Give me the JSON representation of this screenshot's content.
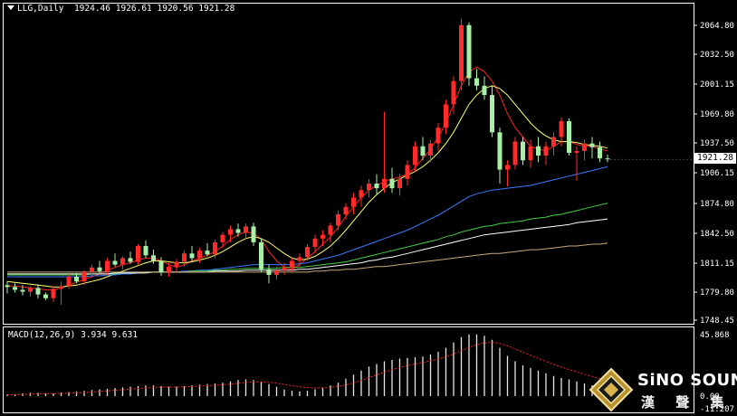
{
  "header": {
    "symbol": "LLG,Daily",
    "open": "1924.46",
    "high": "1926.61",
    "low": "1920.56",
    "close": "1921.28"
  },
  "macd": {
    "label": "MACD(12,26,9)",
    "main": "3.934",
    "signal": "9.631"
  },
  "price_axis_labels": [
    "2064.80",
    "2032.50",
    "2001.15",
    "1969.80",
    "1937.50",
    "1906.15",
    "1874.80",
    "1842.50",
    "1811.15",
    "1779.80",
    "1748.45"
  ],
  "macd_axis_labels": [
    "45.868",
    "0.00",
    "-11.207"
  ],
  "current_price": "1921.28",
  "logo": {
    "brand": "SiNO SOUND",
    "chinese": "漢 聲 集 團"
  },
  "colors": {
    "bull": "#ff2a2a",
    "bear": "#a8f0a8",
    "background": "#000000",
    "frame": "#ffffff"
  },
  "chart_data": {
    "type": "candlestick",
    "price_range": [
      1748.45,
      2080
    ],
    "macd_range": [
      -11.207,
      45.868
    ],
    "candles": [
      [
        1786,
        1790,
        1777,
        1784
      ],
      [
        1784,
        1788,
        1778,
        1781
      ],
      [
        1781,
        1786,
        1775,
        1779
      ],
      [
        1779,
        1785,
        1774,
        1783
      ],
      [
        1783,
        1787,
        1772,
        1776
      ],
      [
        1776,
        1778,
        1770,
        1772
      ],
      [
        1772,
        1785,
        1768,
        1782
      ],
      [
        1782,
        1790,
        1765,
        1785
      ],
      [
        1785,
        1798,
        1782,
        1795
      ],
      [
        1795,
        1799,
        1788,
        1790
      ],
      [
        1790,
        1802,
        1786,
        1800
      ],
      [
        1800,
        1808,
        1796,
        1805
      ],
      [
        1805,
        1812,
        1799,
        1801
      ],
      [
        1801,
        1815,
        1797,
        1812
      ],
      [
        1812,
        1820,
        1806,
        1808
      ],
      [
        1808,
        1817,
        1803,
        1815
      ],
      [
        1815,
        1822,
        1809,
        1811
      ],
      [
        1811,
        1830,
        1808,
        1828
      ],
      [
        1828,
        1834,
        1815,
        1818
      ],
      [
        1818,
        1824,
        1809,
        1812
      ],
      [
        1812,
        1816,
        1796,
        1800
      ],
      [
        1800,
        1810,
        1795,
        1806
      ],
      [
        1806,
        1814,
        1800,
        1811
      ],
      [
        1811,
        1823,
        1806,
        1820
      ],
      [
        1820,
        1828,
        1812,
        1815
      ],
      [
        1815,
        1826,
        1810,
        1823
      ],
      [
        1823,
        1831,
        1817,
        1819
      ],
      [
        1819,
        1835,
        1815,
        1832
      ],
      [
        1832,
        1843,
        1826,
        1840
      ],
      [
        1840,
        1850,
        1832,
        1846
      ],
      [
        1846,
        1852,
        1838,
        1842
      ],
      [
        1842,
        1852,
        1836,
        1849
      ],
      [
        1849,
        1853,
        1828,
        1832
      ],
      [
        1832,
        1836,
        1800,
        1803
      ],
      [
        1803,
        1808,
        1788,
        1797
      ],
      [
        1797,
        1806,
        1792,
        1802
      ],
      [
        1802,
        1810,
        1797,
        1805
      ],
      [
        1805,
        1815,
        1800,
        1812
      ],
      [
        1812,
        1820,
        1806,
        1816
      ],
      [
        1816,
        1830,
        1812,
        1827
      ],
      [
        1827,
        1840,
        1820,
        1836
      ],
      [
        1836,
        1845,
        1828,
        1840
      ],
      [
        1840,
        1853,
        1832,
        1850
      ],
      [
        1850,
        1866,
        1845,
        1862
      ],
      [
        1862,
        1874,
        1856,
        1870
      ],
      [
        1870,
        1885,
        1862,
        1880
      ],
      [
        1880,
        1893,
        1870,
        1888
      ],
      [
        1888,
        1900,
        1880,
        1895
      ],
      [
        1895,
        1905,
        1884,
        1890
      ],
      [
        1890,
        1972,
        1885,
        1900
      ],
      [
        1900,
        1912,
        1885,
        1890
      ],
      [
        1890,
        1905,
        1882,
        1900
      ],
      [
        1900,
        1920,
        1893,
        1915
      ],
      [
        1915,
        1940,
        1908,
        1935
      ],
      [
        1935,
        1945,
        1920,
        1925
      ],
      [
        1925,
        1942,
        1918,
        1938
      ],
      [
        1938,
        1960,
        1930,
        1955
      ],
      [
        1955,
        1985,
        1948,
        1980
      ],
      [
        1980,
        2010,
        1970,
        2005
      ],
      [
        2005,
        2072,
        1995,
        2065
      ],
      [
        2065,
        2068,
        2000,
        2008
      ],
      [
        2008,
        2018,
        1995,
        2000
      ],
      [
        2000,
        2010,
        1985,
        1990
      ],
      [
        1990,
        2000,
        1945,
        1950
      ],
      [
        1950,
        1955,
        1895,
        1910
      ],
      [
        1910,
        1920,
        1892,
        1915
      ],
      [
        1915,
        1945,
        1910,
        1940
      ],
      [
        1940,
        1945,
        1915,
        1920
      ],
      [
        1920,
        1942,
        1912,
        1935
      ],
      [
        1935,
        1945,
        1918,
        1925
      ],
      [
        1925,
        1940,
        1915,
        1935
      ],
      [
        1935,
        1950,
        1925,
        1945
      ],
      [
        1945,
        1966,
        1935,
        1962
      ],
      [
        1962,
        1965,
        1925,
        1928
      ],
      [
        1928,
        1935,
        1898,
        1930
      ],
      [
        1930,
        1942,
        1920,
        1938
      ],
      [
        1938,
        1945,
        1922,
        1934
      ],
      [
        1934,
        1940,
        1918,
        1922
      ],
      [
        1922,
        1926,
        1918,
        1921
      ]
    ],
    "ma_lines": [
      {
        "color": "#ff2020",
        "values": [
          1785,
          1785,
          1784,
          1783,
          1782,
          1781,
          1781,
          1783,
          1786,
          1789,
          1792,
          1795,
          1798,
          1802,
          1805,
          1808,
          1810,
          1813,
          1815,
          1815,
          1812,
          1808,
          1805,
          1808,
          1812,
          1815,
          1818,
          1822,
          1828,
          1835,
          1840,
          1843,
          1842,
          1835,
          1822,
          1812,
          1805,
          1803,
          1808,
          1815,
          1822,
          1830,
          1838,
          1848,
          1860,
          1870,
          1880,
          1888,
          1893,
          1897,
          1900,
          1902,
          1905,
          1912,
          1922,
          1932,
          1945,
          1960,
          1980,
          2000,
          2015,
          2020,
          2015,
          2005,
          1990,
          1970,
          1955,
          1945,
          1935,
          1932,
          1930,
          1935,
          1940,
          1940,
          1937,
          1935,
          1935,
          1932,
          1930
        ]
      },
      {
        "color": "#ffff66",
        "values": [
          1790,
          1789,
          1788,
          1787,
          1786,
          1785,
          1784,
          1784,
          1785,
          1786,
          1788,
          1790,
          1792,
          1795,
          1798,
          1801,
          1804,
          1807,
          1810,
          1812,
          1812,
          1811,
          1810,
          1810,
          1811,
          1813,
          1815,
          1818,
          1822,
          1827,
          1832,
          1836,
          1838,
          1836,
          1832,
          1826,
          1820,
          1815,
          1813,
          1814,
          1817,
          1822,
          1828,
          1836,
          1845,
          1855,
          1865,
          1875,
          1883,
          1890,
          1896,
          1900,
          1904,
          1908,
          1913,
          1920,
          1928,
          1938,
          1950,
          1965,
          1980,
          1990,
          1997,
          2000,
          1997,
          1990,
          1980,
          1970,
          1960,
          1952,
          1946,
          1942,
          1940,
          1940,
          1939,
          1937,
          1936,
          1935,
          1933
        ]
      },
      {
        "color": "#3a7bff",
        "values": [
          1795,
          1795,
          1795,
          1795,
          1795,
          1795,
          1795,
          1795,
          1795,
          1795,
          1795,
          1796,
          1796,
          1797,
          1797,
          1798,
          1798,
          1799,
          1800,
          1800,
          1800,
          1800,
          1800,
          1801,
          1801,
          1802,
          1802,
          1803,
          1804,
          1805,
          1806,
          1807,
          1808,
          1808,
          1808,
          1808,
          1808,
          1808,
          1809,
          1810,
          1812,
          1814,
          1816,
          1818,
          1821,
          1824,
          1827,
          1830,
          1833,
          1836,
          1839,
          1842,
          1845,
          1849,
          1853,
          1857,
          1861,
          1866,
          1871,
          1876,
          1881,
          1884,
          1886,
          1888,
          1889,
          1890,
          1891,
          1892,
          1893,
          1895,
          1897,
          1899,
          1901,
          1903,
          1905,
          1907,
          1909,
          1911,
          1913
        ]
      },
      {
        "color": "#44cc44",
        "values": [
          1797,
          1797,
          1797,
          1797,
          1797,
          1797,
          1797,
          1797,
          1797,
          1797,
          1797,
          1798,
          1798,
          1798,
          1798,
          1799,
          1799,
          1799,
          1800,
          1800,
          1800,
          1800,
          1800,
          1800,
          1801,
          1801,
          1801,
          1802,
          1802,
          1803,
          1803,
          1804,
          1804,
          1804,
          1804,
          1804,
          1805,
          1805,
          1805,
          1806,
          1807,
          1808,
          1809,
          1810,
          1811,
          1813,
          1815,
          1817,
          1819,
          1821,
          1823,
          1825,
          1827,
          1829,
          1831,
          1833,
          1835,
          1838,
          1840,
          1843,
          1845,
          1847,
          1849,
          1850,
          1852,
          1853,
          1854,
          1855,
          1857,
          1858,
          1859,
          1861,
          1862,
          1864,
          1866,
          1868,
          1870,
          1872,
          1874
        ]
      },
      {
        "color": "#ffffff",
        "values": [
          1798,
          1798,
          1798,
          1798,
          1798,
          1798,
          1798,
          1798,
          1798,
          1798,
          1798,
          1798,
          1798,
          1798,
          1799,
          1799,
          1799,
          1799,
          1799,
          1800,
          1800,
          1800,
          1800,
          1800,
          1800,
          1800,
          1800,
          1801,
          1801,
          1801,
          1801,
          1802,
          1802,
          1802,
          1802,
          1802,
          1802,
          1802,
          1803,
          1803,
          1804,
          1805,
          1806,
          1807,
          1808,
          1809,
          1810,
          1812,
          1813,
          1815,
          1816,
          1818,
          1820,
          1822,
          1824,
          1826,
          1828,
          1830,
          1832,
          1834,
          1836,
          1838,
          1840,
          1841,
          1842,
          1843,
          1844,
          1845,
          1846,
          1847,
          1848,
          1849,
          1850,
          1851,
          1853,
          1854,
          1855,
          1856,
          1857
        ]
      },
      {
        "color": "#c8a878",
        "values": [
          1800,
          1800,
          1800,
          1800,
          1800,
          1800,
          1800,
          1800,
          1800,
          1800,
          1800,
          1800,
          1800,
          1800,
          1800,
          1800,
          1800,
          1800,
          1800,
          1800,
          1800,
          1800,
          1800,
          1800,
          1800,
          1800,
          1800,
          1800,
          1800,
          1800,
          1800,
          1800,
          1800,
          1800,
          1800,
          1800,
          1800,
          1800,
          1800,
          1800,
          1801,
          1801,
          1802,
          1802,
          1803,
          1803,
          1804,
          1805,
          1806,
          1806,
          1807,
          1808,
          1809,
          1810,
          1811,
          1812,
          1813,
          1814,
          1815,
          1816,
          1817,
          1818,
          1819,
          1820,
          1820,
          1821,
          1822,
          1823,
          1824,
          1824,
          1825,
          1826,
          1827,
          1828,
          1828,
          1829,
          1830,
          1830,
          1831
        ]
      }
    ],
    "macd_hist": [
      1,
      1.5,
      2,
      2.5,
      2.5,
      2,
      2,
      2.5,
      3,
      3.5,
      4,
      4.5,
      5,
      5.5,
      6,
      6.5,
      7,
      7.5,
      8,
      8,
      7.5,
      7,
      7,
      7.5,
      8,
      8.5,
      9,
      9.5,
      10,
      11,
      12,
      12.5,
      12,
      11,
      9,
      7,
      5,
      4,
      3.5,
      4,
      5,
      6.5,
      8,
      10,
      13,
      16,
      19,
      22,
      24,
      26,
      27,
      28,
      28.5,
      29,
      29.5,
      31,
      33,
      36,
      40,
      44,
      46,
      46,
      45,
      42,
      36,
      30,
      26,
      23,
      21,
      19,
      17,
      15,
      13.5,
      12.5,
      11,
      9.5,
      8,
      6.5,
      4
    ]
  }
}
